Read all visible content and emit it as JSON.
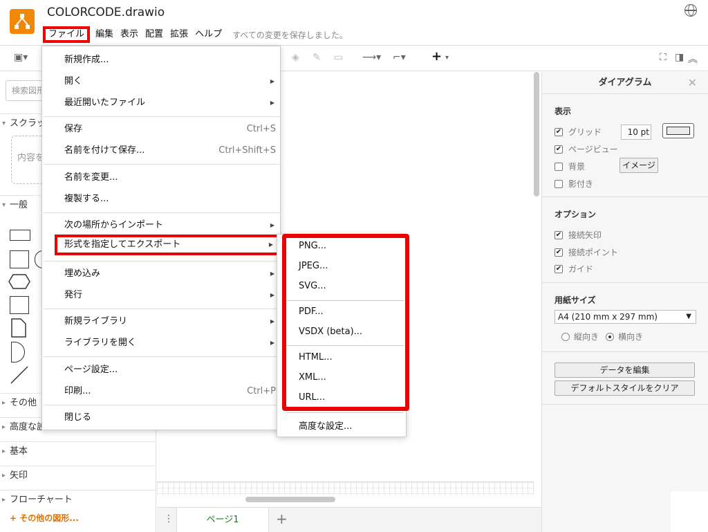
{
  "header": {
    "title": "COLORCODE.drawio",
    "menu": [
      "ファイル",
      "編集",
      "表示",
      "配置",
      "拡張",
      "ヘルプ"
    ],
    "save_status": "すべての変更を保存しました。"
  },
  "sidebar": {
    "search_placeholder": "検索図形",
    "scratchpad": "スクラッ",
    "scratchpad_hint": "内容を",
    "general": "一般",
    "sections": [
      "その他",
      "高度な設",
      "基本",
      "矢印",
      "フローチャート"
    ],
    "more_shapes": "+ その他の図形..."
  },
  "file_menu": {
    "items": [
      {
        "label": "新規作成...",
        "arrow": "",
        "shortcut": ""
      },
      {
        "label": "開く",
        "arrow": "▶",
        "shortcut": ""
      },
      {
        "label": "最近開いたファイル",
        "arrow": "▶",
        "shortcut": ""
      },
      {
        "label": "保存",
        "arrow": "",
        "shortcut": "Ctrl+S"
      },
      {
        "label": "名前を付けて保存...",
        "arrow": "",
        "shortcut": "Ctrl+Shift+S"
      },
      {
        "label": "名前を変更...",
        "arrow": "",
        "shortcut": ""
      },
      {
        "label": "複製する...",
        "arrow": "",
        "shortcut": ""
      },
      {
        "label": "次の場所からインポート",
        "arrow": "▶",
        "shortcut": ""
      },
      {
        "label": "形式を指定してエクスポート",
        "arrow": "▶",
        "shortcut": ""
      },
      {
        "label": "埋め込み",
        "arrow": "▶",
        "shortcut": ""
      },
      {
        "label": "発行",
        "arrow": "▶",
        "shortcut": ""
      },
      {
        "label": "新規ライブラリ",
        "arrow": "▶",
        "shortcut": ""
      },
      {
        "label": "ライブラリを開く",
        "arrow": "▶",
        "shortcut": ""
      },
      {
        "label": "ページ設定...",
        "arrow": "",
        "shortcut": ""
      },
      {
        "label": "印刷...",
        "arrow": "",
        "shortcut": "Ctrl+P"
      },
      {
        "label": "閉じる",
        "arrow": "",
        "shortcut": ""
      }
    ]
  },
  "export_menu": {
    "items": [
      "PNG...",
      "JPEG...",
      "SVG...",
      "PDF...",
      "VSDX (beta)...",
      "HTML...",
      "XML...",
      "URL...",
      "高度な設定..."
    ]
  },
  "canvas": {
    "page_tab": "ページ1"
  },
  "format_panel": {
    "title": "ダイアグラム",
    "view_label": "表示",
    "grid": "グリッド",
    "grid_size": "10 pt",
    "page_view": "ページビュー",
    "background": "背景",
    "image_button": "イメージ",
    "shadow": "影付き",
    "options_label": "オプション",
    "connection_arrows": "接続矢印",
    "connection_points": "接続ポイント",
    "guides": "ガイド",
    "paper_size_label": "用紙サイズ",
    "paper_size": "A4 (210 mm x 297 mm)",
    "portrait": "縦向き",
    "landscape": "横向き",
    "edit_data": "データを編集",
    "clear_default_style": "デフォルトスタイルをクリア",
    "check": "✔"
  },
  "colors": {
    "accent_red": "#ee0000",
    "logo_orange": "#f08705",
    "page_tab_green": "#1a7a1a"
  }
}
